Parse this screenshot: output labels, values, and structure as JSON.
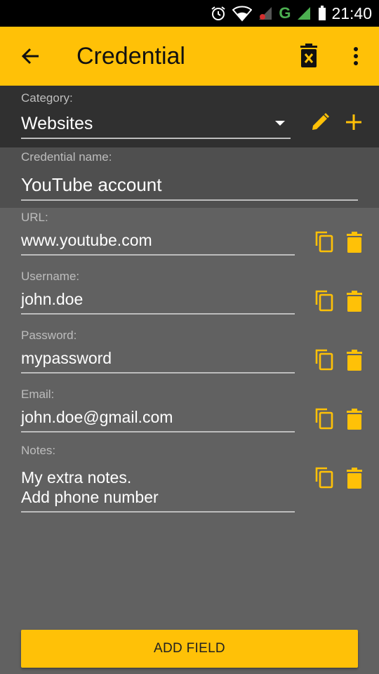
{
  "status_bar": {
    "time": "21:40",
    "network": "G",
    "icons": [
      "alarm-icon",
      "wifi-icon",
      "signal-icon",
      "battery-icon"
    ]
  },
  "app_bar": {
    "title": "Credential",
    "back_icon": "arrow-back-icon",
    "delete_icon": "delete-forever-icon",
    "more_icon": "more-vert-icon"
  },
  "category": {
    "label": "Category:",
    "selected": "Websites",
    "edit_icon": "pencil-icon",
    "add_icon": "plus-icon"
  },
  "credential_name": {
    "label": "Credential name:",
    "value": "YouTube account"
  },
  "fields": [
    {
      "label": "URL:",
      "value": "www.youtube.com"
    },
    {
      "label": "Username:",
      "value": "john.doe"
    },
    {
      "label": "Password:",
      "value": "mypassword"
    },
    {
      "label": "Email:",
      "value": "john.doe@gmail.com"
    },
    {
      "label": "Notes:",
      "value": "My extra notes.\nAdd phone  number"
    }
  ],
  "add_field_label": "ADD FIELD",
  "colors": {
    "accent": "#FFC107",
    "background": "#616161",
    "category_bg": "#303030",
    "name_bg": "#4F4F4F"
  }
}
